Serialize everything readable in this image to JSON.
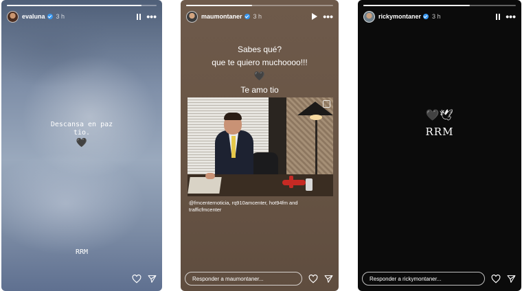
{
  "stories": [
    {
      "username": "evaluna",
      "time": "3 h",
      "progress": 0.9,
      "lines": [
        "Descansa en paz",
        "tio."
      ],
      "heart": "🖤",
      "signature": "RRM"
    },
    {
      "username": "maumontaner",
      "time": "3 h",
      "progress": 0.45,
      "lines": [
        "Sabes qué?",
        "que te quiero muchoooo!!!",
        "Te amo tio"
      ],
      "heart": "🖤",
      "caption": "@fmcenternoticia, rq910amcenter, hot94fm and trafficfmcenter",
      "reply_placeholder": "Responder a maumontaner..."
    },
    {
      "username": "rickymontaner",
      "time": "3 h",
      "progress": 0.7,
      "hearts": "🖤",
      "dove": "🕊",
      "signature": "RRM",
      "reply_placeholder": "Responder a rickymontaner..."
    }
  ],
  "icons": {
    "heart": "heart-icon",
    "send": "send-icon",
    "pause": "pause-icon",
    "play": "play-icon",
    "more": "more-icon",
    "verified": "verified-badge-icon"
  },
  "colors": {
    "verified": "#3897f0",
    "story3_bg": "#0b0b0b"
  }
}
